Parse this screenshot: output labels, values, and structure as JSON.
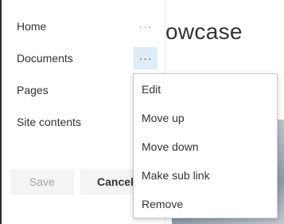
{
  "nav": {
    "items": [
      {
        "label": "Home",
        "more_icon": "···"
      },
      {
        "label": "Documents",
        "more_icon": "···"
      },
      {
        "label": "Pages"
      },
      {
        "label": "Site contents"
      }
    ]
  },
  "buttons": {
    "save_label": "Save",
    "cancel_label": "Cancel"
  },
  "page": {
    "title_fragment": "owcase"
  },
  "context_menu": {
    "items": [
      "Edit",
      "Move up",
      "Move down",
      "Make sub link",
      "Remove"
    ]
  },
  "colors": {
    "active_ellipsis_bg": "#deecf9",
    "disabled_text": "#a6a6a6",
    "menu_border": "#c8c8c8"
  }
}
